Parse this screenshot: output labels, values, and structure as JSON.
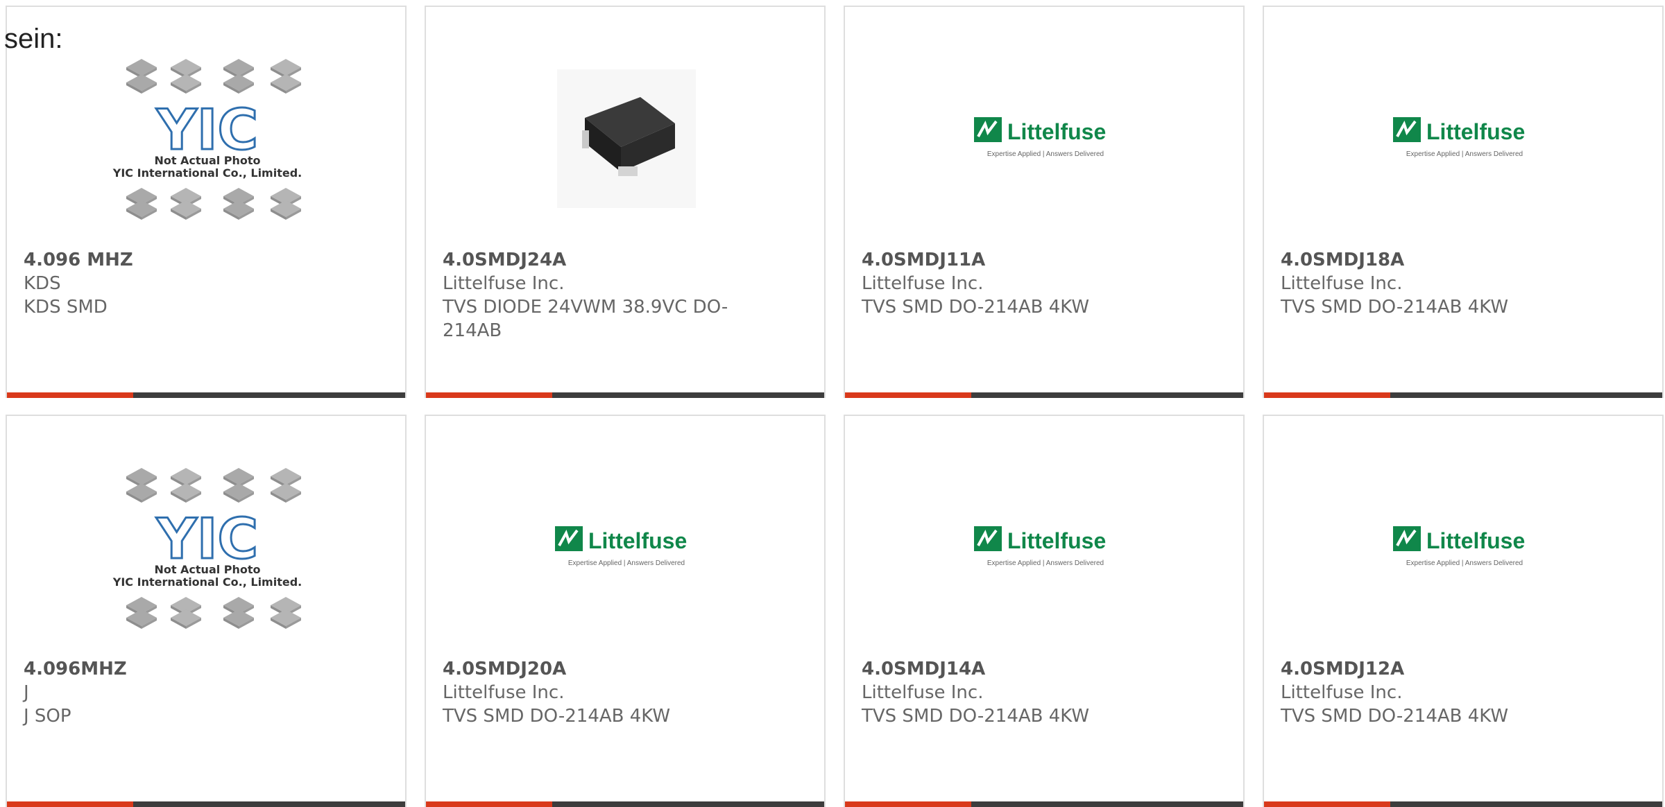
{
  "intro_text": "sein:",
  "colors": {
    "accent": "#d9391b",
    "bar": "#3d3d3d",
    "border": "#dedede",
    "littelfuse_green": "#10874a",
    "yic_blue": "#2f6fae"
  },
  "yic_placeholder": {
    "logo": "YIC",
    "line1": "Not Actual Photo",
    "line2": "YIC International Co., Limited."
  },
  "littelfuse_logo": {
    "name": "Littelfuse",
    "tagline": "Expertise Applied | Answers Delivered"
  },
  "products": [
    {
      "part": "4.096 MHZ",
      "manufacturer": "KDS",
      "description": "KDS SMD",
      "image": "yic-placeholder"
    },
    {
      "part": "4.0SMDJ24A",
      "manufacturer": "Littelfuse Inc.",
      "description": "TVS DIODE 24VWM 38.9VC DO-214AB",
      "image": "diode-photo"
    },
    {
      "part": "4.0SMDJ11A",
      "manufacturer": "Littelfuse Inc.",
      "description": "TVS SMD DO-214AB 4KW",
      "image": "littelfuse-logo"
    },
    {
      "part": "4.0SMDJ18A",
      "manufacturer": "Littelfuse Inc.",
      "description": "TVS SMD DO-214AB 4KW",
      "image": "littelfuse-logo"
    },
    {
      "part": "4.096MHZ",
      "manufacturer": "J",
      "description": "J SOP",
      "image": "yic-placeholder"
    },
    {
      "part": "4.0SMDJ20A",
      "manufacturer": "Littelfuse Inc.",
      "description": "TVS SMD DO-214AB 4KW",
      "image": "littelfuse-logo"
    },
    {
      "part": "4.0SMDJ14A",
      "manufacturer": "Littelfuse Inc.",
      "description": "TVS SMD DO-214AB 4KW",
      "image": "littelfuse-logo"
    },
    {
      "part": "4.0SMDJ12A",
      "manufacturer": "Littelfuse Inc.",
      "description": "TVS SMD DO-214AB 4KW",
      "image": "littelfuse-logo"
    }
  ]
}
